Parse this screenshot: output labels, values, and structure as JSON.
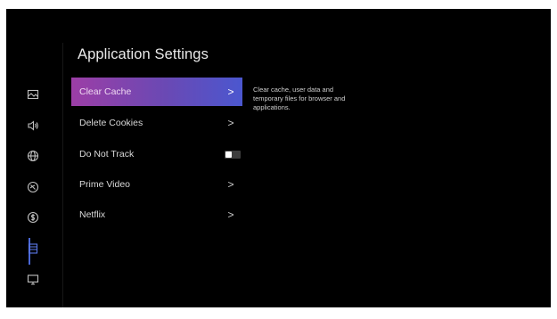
{
  "page": {
    "title": "Application Settings"
  },
  "menu": {
    "items": [
      {
        "label": "Clear Cache",
        "control": "chevron",
        "selected": true
      },
      {
        "label": "Delete Cookies",
        "control": "chevron",
        "selected": false
      },
      {
        "label": "Do Not Track",
        "control": "toggle",
        "toggle_state": "off",
        "selected": false
      },
      {
        "label": "Prime Video",
        "control": "chevron",
        "selected": false
      },
      {
        "label": "Netflix",
        "control": "chevron",
        "selected": false
      }
    ],
    "chevron_glyph": ">"
  },
  "description": {
    "text": "Clear cache, user data and temporary files for browser and applications."
  },
  "sidebar": {
    "icons": [
      {
        "name": "picture-icon",
        "active": false
      },
      {
        "name": "sound-icon",
        "active": false
      },
      {
        "name": "network-icon",
        "active": false
      },
      {
        "name": "accessibility-icon",
        "active": false
      },
      {
        "name": "privacy-icon",
        "active": false
      },
      {
        "name": "applications-icon",
        "active": true
      },
      {
        "name": "system-icon",
        "active": false
      }
    ]
  },
  "colors": {
    "selected_gradient_start": "#9c3ea6",
    "selected_gradient_end": "#4b57cf",
    "active_indicator": "#4a67d6",
    "background": "#000000"
  }
}
